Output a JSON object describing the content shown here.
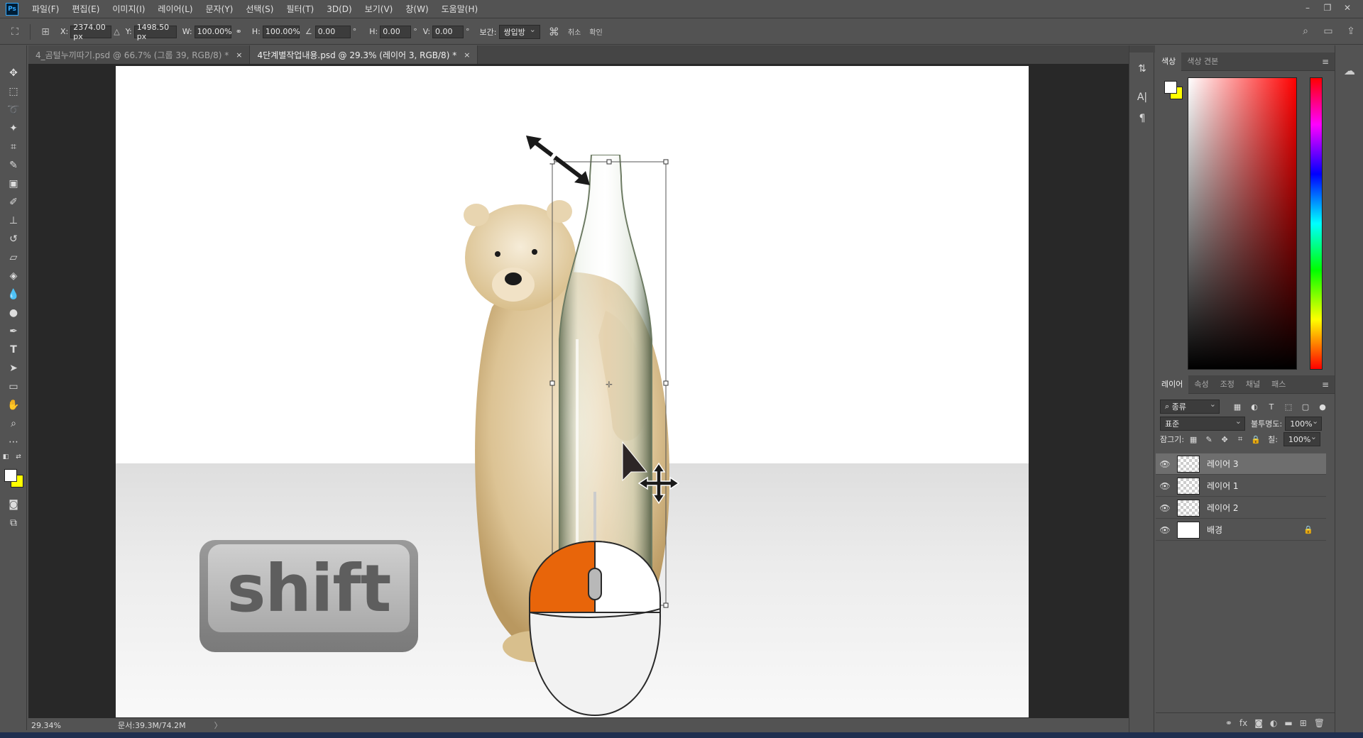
{
  "app": {
    "logo": "Ps",
    "menu": [
      "파일(F)",
      "편집(E)",
      "이미지(I)",
      "레이어(L)",
      "문자(Y)",
      "선택(S)",
      "필터(T)",
      "3D(D)",
      "보기(V)",
      "창(W)",
      "도움말(H)"
    ],
    "window_controls": [
      "–",
      "❐",
      "✕"
    ]
  },
  "options": {
    "x_label": "X:",
    "x_value": "2374.00 px",
    "y_label": "Y:",
    "y_value": "1498.50 px",
    "w_label": "W:",
    "w_value": "100.00%",
    "h_label": "H:",
    "h_value": "100.00%",
    "angle_value": "0.00",
    "angle_unit": "°",
    "hskew_label": "H:",
    "hskew_value": "0.00",
    "vskew_label": "V:",
    "vskew_value": "0.00",
    "deg": "°",
    "interp_label": "보간:",
    "interp_value": "쌍입방",
    "cancel_label": "취소",
    "commit_label": "확인"
  },
  "tabs": [
    {
      "label": "4_곰털누끼따기.psd @ 66.7% (그룹 39, RGB/8) *",
      "close": "×"
    },
    {
      "label": "4단계별작업내용.psd @ 29.3% (레이어 3, RGB/8) *",
      "close": "×"
    }
  ],
  "canvas": {
    "shift_key_label": "shift"
  },
  "status": {
    "zoom": "29.34%",
    "doc": "문서:39.3M/74.2M",
    "arrow": "〉"
  },
  "color_panel": {
    "tabs": [
      "색상",
      "색상 견본"
    ]
  },
  "layers_panel": {
    "tabs": [
      "레이어",
      "속성",
      "조정",
      "채널",
      "패스"
    ],
    "filter_label": "종류",
    "blend_mode": "표준",
    "opacity_label": "불투명도:",
    "opacity_value": "100%",
    "lock_label": "잠그기:",
    "fill_label": "칠:",
    "fill_value": "100%",
    "layers": [
      {
        "name": "레이어 3",
        "selected": true
      },
      {
        "name": "레이어 1",
        "selected": false
      },
      {
        "name": "레이어 2",
        "selected": false
      },
      {
        "name": "배경",
        "selected": false
      }
    ]
  },
  "colors": {
    "foreground": "#ffffff",
    "background": "#ffff00",
    "mouse_left_button": "#e8650a"
  }
}
